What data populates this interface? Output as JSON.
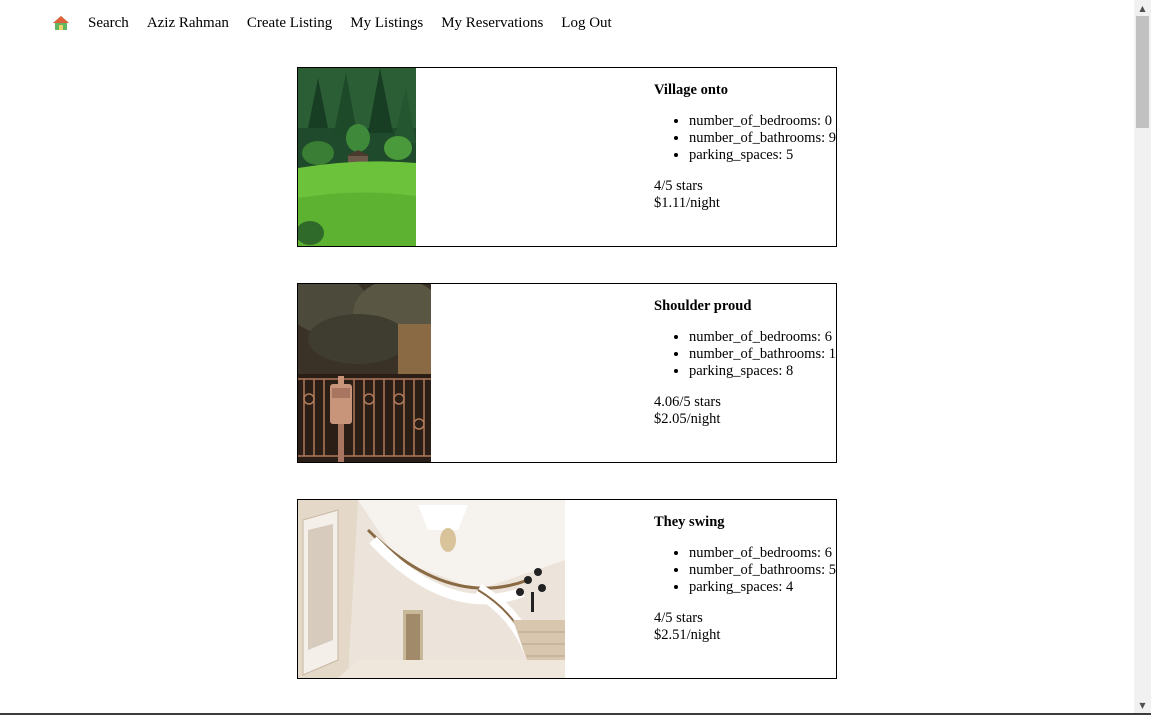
{
  "nav": {
    "home_icon": "home-icon",
    "links": [
      "Search",
      "Aziz Rahman",
      "Create Listing",
      "My Listings",
      "My Reservations",
      "Log Out"
    ]
  },
  "listings": [
    {
      "title": "Village onto",
      "features": [
        "number_of_bedrooms: 0",
        "number_of_bathrooms: 9",
        "parking_spaces: 5"
      ],
      "rating": "4/5 stars",
      "price": "$1.11/night"
    },
    {
      "title": "Shoulder proud",
      "features": [
        "number_of_bedrooms: 6",
        "number_of_bathrooms: 1",
        "parking_spaces: 8"
      ],
      "rating": "4.06/5 stars",
      "price": "$2.05/night"
    },
    {
      "title": "They swing",
      "features": [
        "number_of_bedrooms: 6",
        "number_of_bathrooms: 5",
        "parking_spaces: 4"
      ],
      "rating": "4/5 stars",
      "price": "$2.51/night"
    }
  ],
  "colors": {
    "home_roof": "#e0603a",
    "home_base": "#5fb85f",
    "scrollbar_thumb": "#c1c1c1"
  }
}
